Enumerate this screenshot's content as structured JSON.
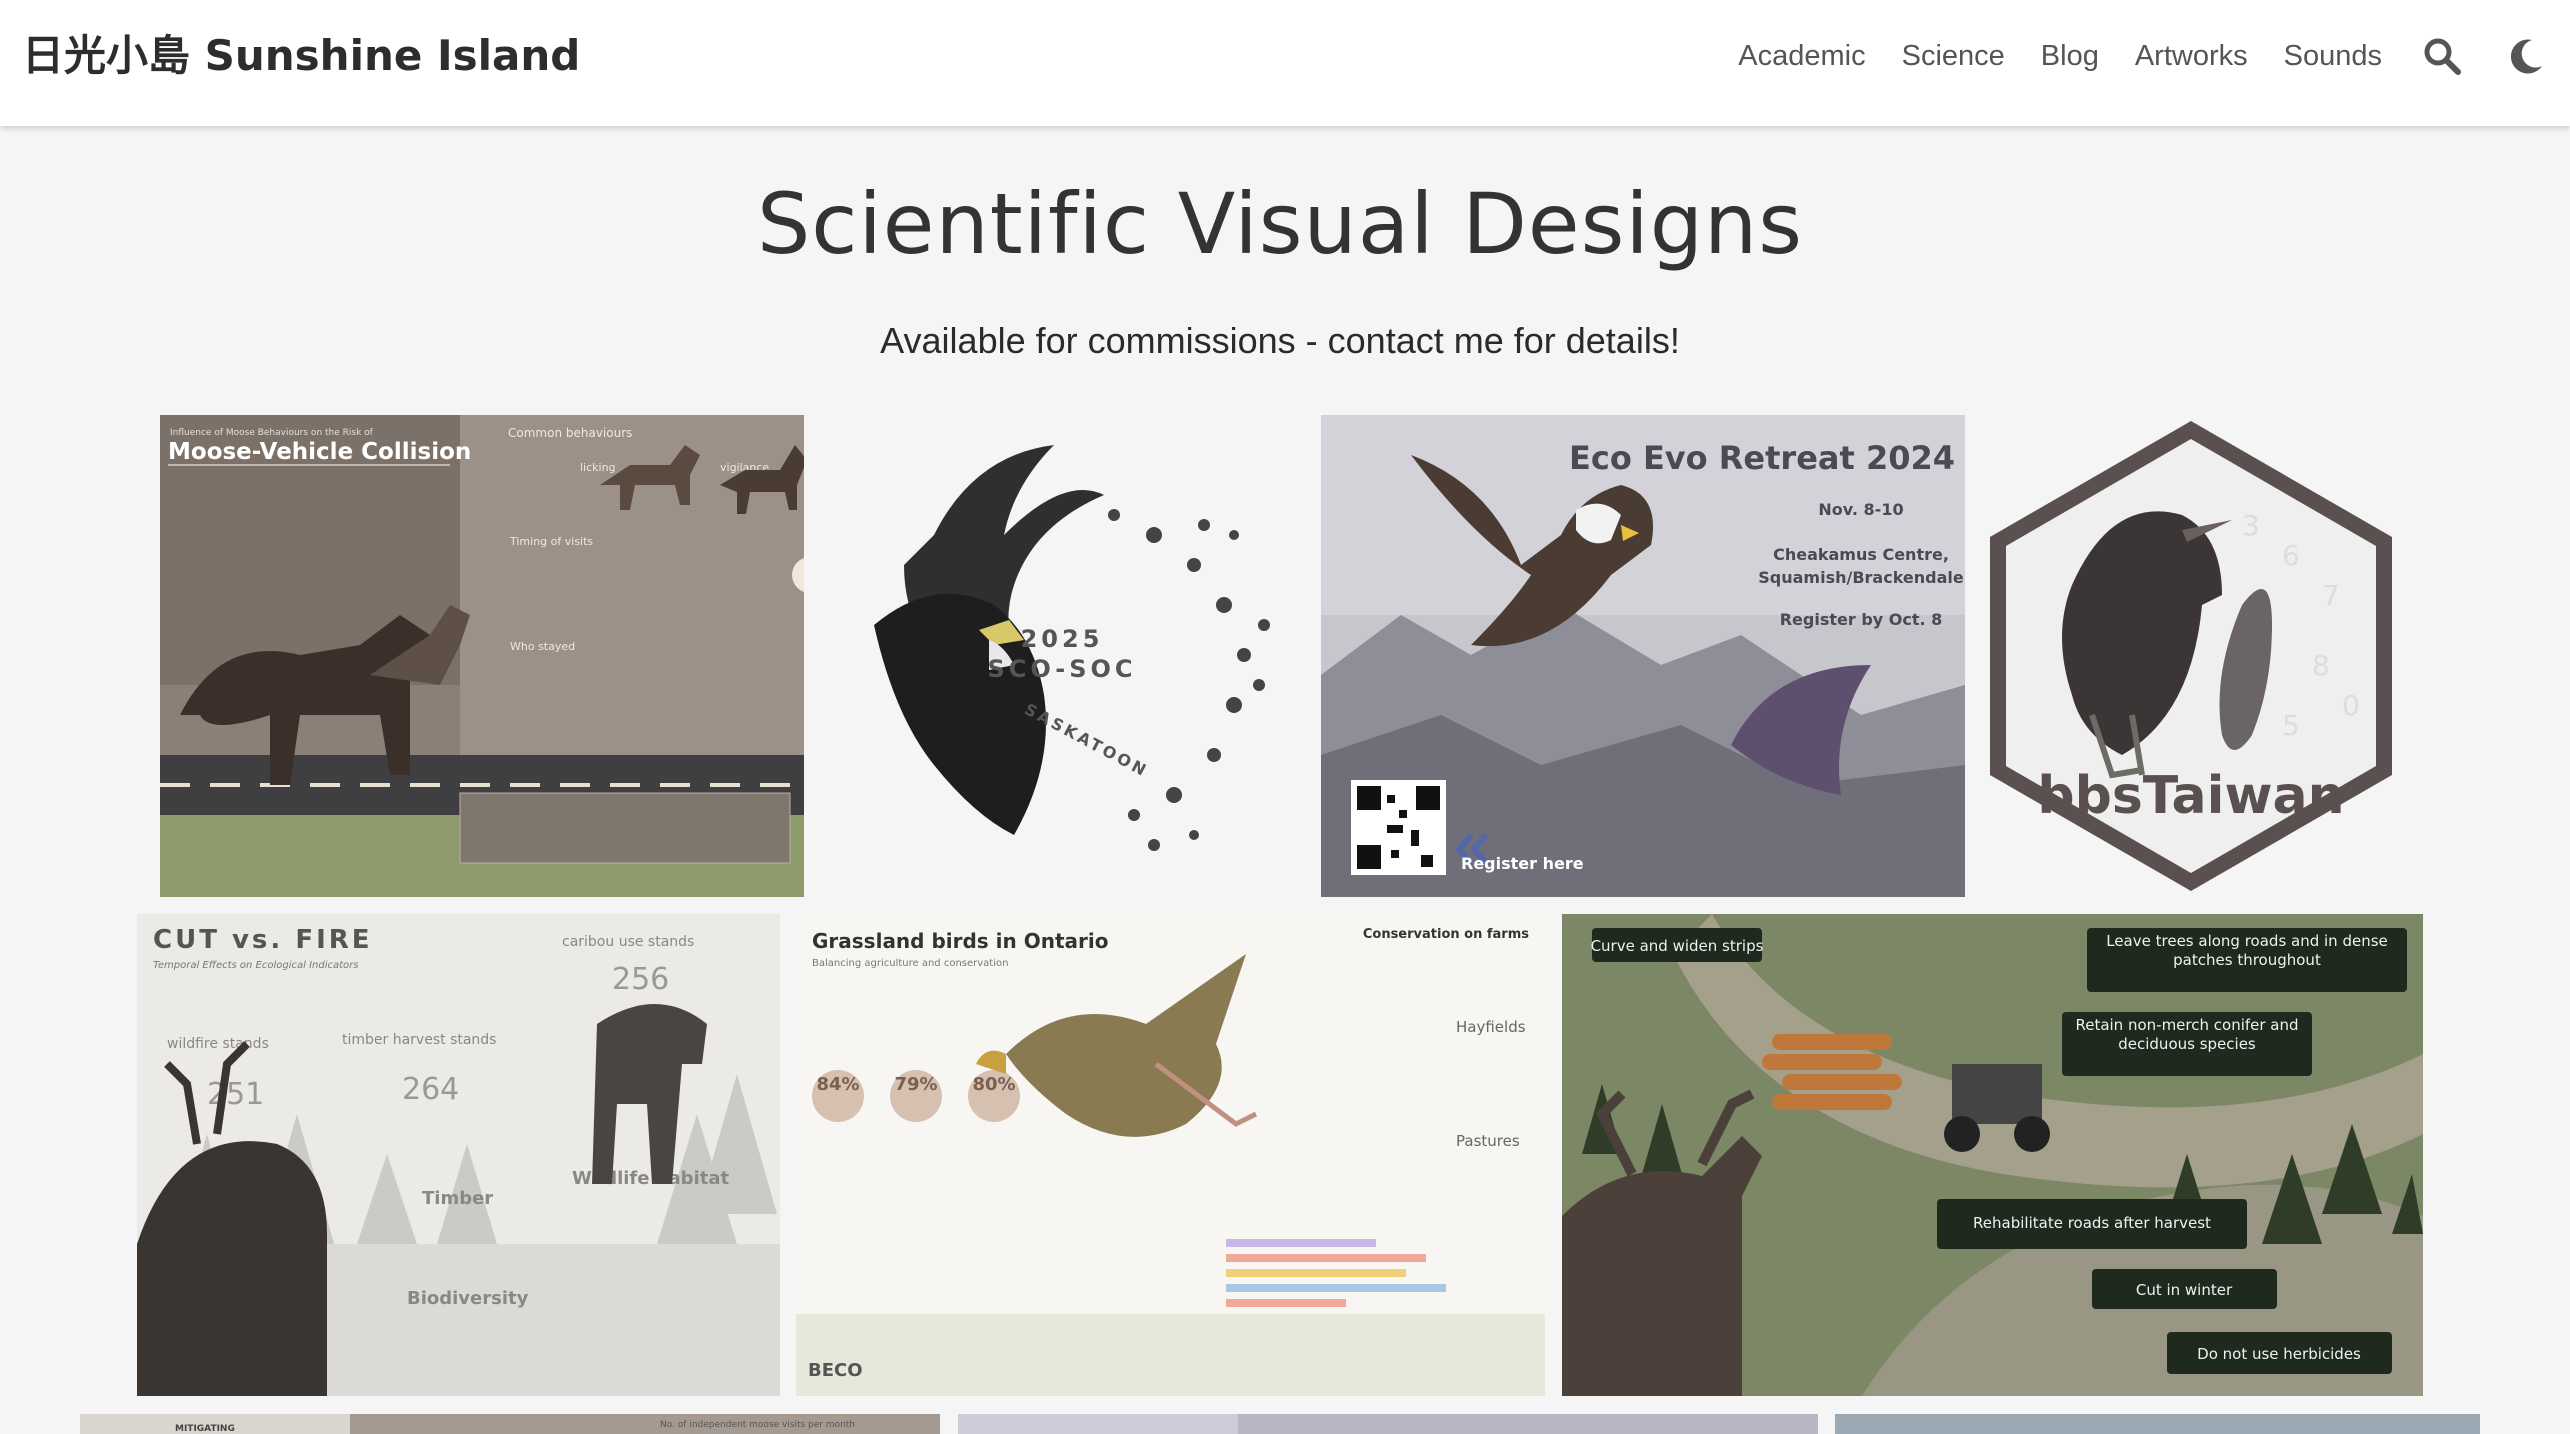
{
  "header": {
    "brand": "日光小島 Sunshine Island",
    "nav": [
      "Academic",
      "Science",
      "Blog",
      "Artworks",
      "Sounds"
    ],
    "icons": [
      "search-icon",
      "moon-icon"
    ]
  },
  "page": {
    "title": "Scientific Visual Designs",
    "subtitle": "Available for commissions - contact me for details!"
  },
  "gallery": {
    "moose": {
      "heading": "Moose-Vehicle Collision",
      "kicker": "Influence of Moose Behaviours on the Risk of",
      "labels": [
        "Common behaviours",
        "licking",
        "vigilance",
        "Timing of visits",
        "Who stayed"
      ]
    },
    "soc": {
      "year": "2025",
      "name": "SCO-SOC",
      "city": "SASKATOON"
    },
    "eco": {
      "title": "Eco Evo Retreat 2024",
      "date": "Nov. 8-10",
      "venue_1": "Cheakamus Centre,",
      "venue_2": "Squamish/Brackendale",
      "deadline": "Register by Oct. 8",
      "cta": "Register here"
    },
    "bbs": {
      "label": "bbsTaiwan"
    },
    "cutfire": {
      "title": "CUT vs. FIRE",
      "subtitle": "Temporal Effects on Ecological Indicators",
      "labels": [
        "wildfire stands",
        "timber harvest stands",
        "caribou use stands",
        "Timber",
        "Biodiversity",
        "Wildlife habitat"
      ],
      "numbers": [
        "251",
        "264",
        "256"
      ]
    },
    "grassland": {
      "title": "Grassland birds in Ontario",
      "subtitle": "Balancing agriculture and conservation",
      "section": "Conservation on farms",
      "percents": [
        "84%",
        "79%",
        "80%"
      ],
      "labels": [
        "Hayfields",
        "Pastures"
      ],
      "logo": "BECO"
    },
    "forestry": {
      "labels": [
        "Curve and widen strips",
        "Leave trees along roads and in dense patches throughout",
        "Retain non-merch conifer and deciduous species",
        "Rehabilitate roads after harvest",
        "Cut in winter",
        "Do not use herbicides"
      ]
    },
    "bottom": {
      "label_1": "MITIGATING",
      "label_2": "No. of independent moose visits per month"
    }
  }
}
